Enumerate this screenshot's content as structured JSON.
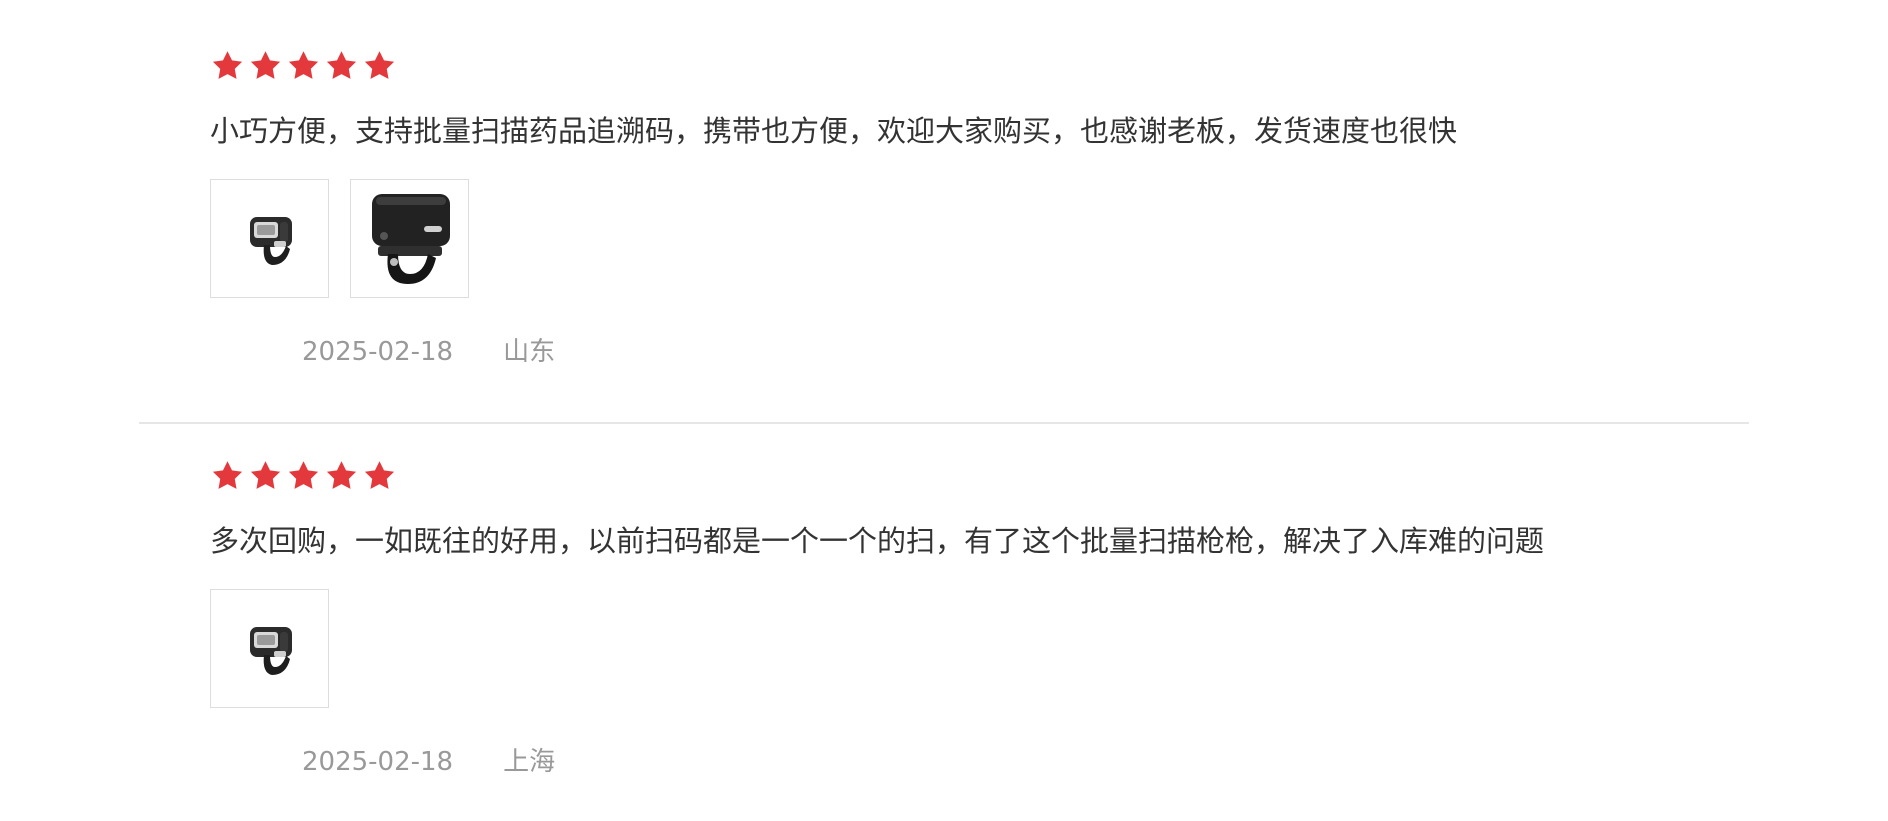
{
  "colors": {
    "star": "#e4393c",
    "text": "#333333",
    "meta": "#999999",
    "divider": "#e6e6e6"
  },
  "reviews": [
    {
      "rating": 5,
      "text": "小巧方便，支持批量扫描药品追溯码，携带也方便，欢迎大家购买，也感谢老板，发货速度也很快",
      "photos": [
        "ring-scanner-small",
        "ring-scanner-large"
      ],
      "date": "2025-02-18",
      "location": "山东"
    },
    {
      "rating": 5,
      "text": "多次回购，一如既往的好用，以前扫码都是一个一个的扫，有了这个批量扫描枪枪，解决了入库难的问题",
      "photos": [
        "ring-scanner-small"
      ],
      "date": "2025-02-18",
      "location": "上海"
    }
  ]
}
